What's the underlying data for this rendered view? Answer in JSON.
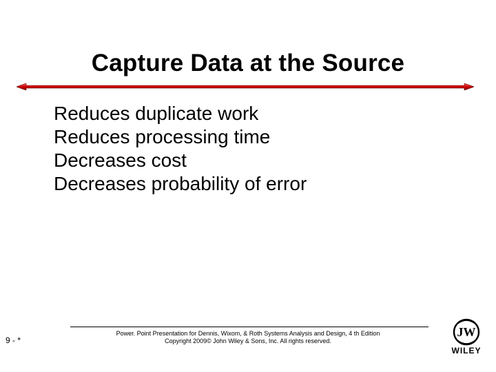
{
  "title": "Capture Data at the Source",
  "bullets": [
    "Reduces duplicate work",
    "Reduces processing time",
    "Decreases cost",
    "Decreases probability of error"
  ],
  "footer": {
    "line1": "Power. Point Presentation for Dennis, Wixom, & Roth Systems Analysis and Design, 4 th Edition",
    "line2": "Copyright 2009© John Wiley & Sons, Inc.  All rights reserved."
  },
  "page_number": "9 - *",
  "publisher_logo_label": "WILEY"
}
